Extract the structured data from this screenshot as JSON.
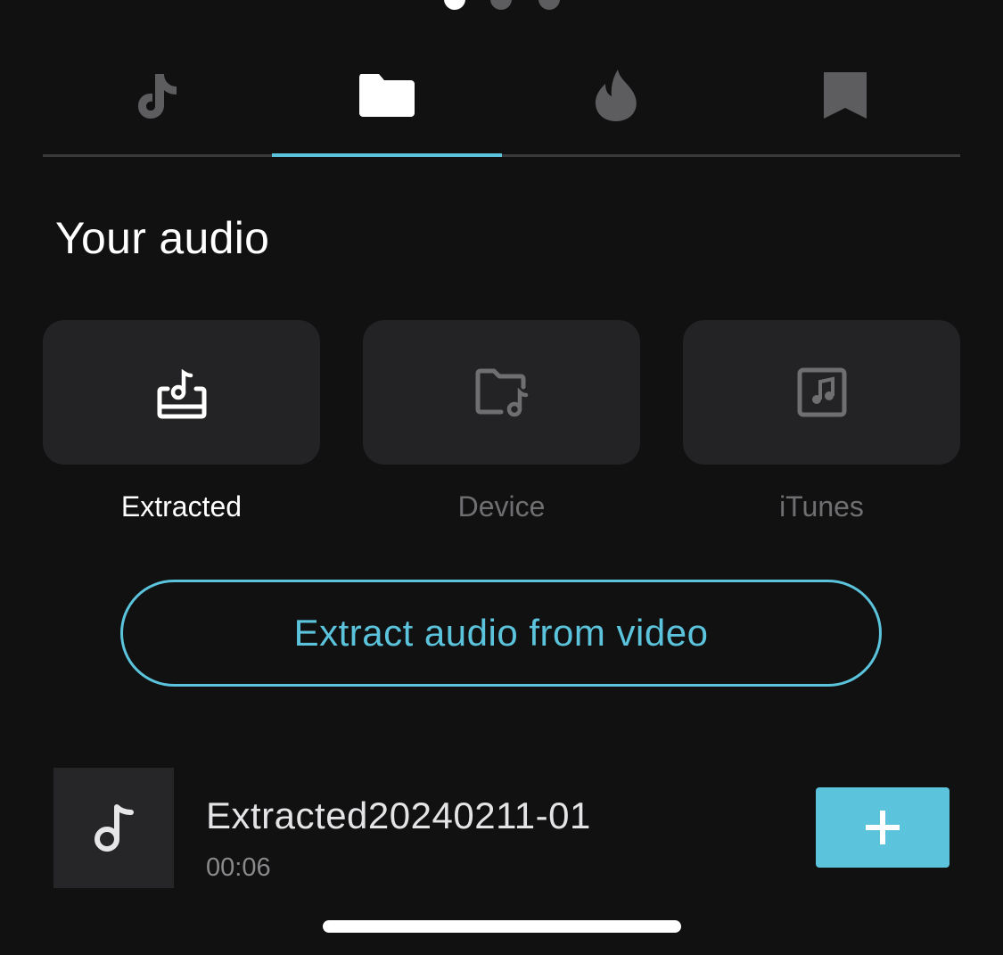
{
  "page_dots": {
    "count": 3,
    "active_index": 0
  },
  "tabs": [
    {
      "id": "tiktok",
      "icon": "tiktok-icon",
      "active": false
    },
    {
      "id": "folder",
      "icon": "folder-icon",
      "active": true
    },
    {
      "id": "trending",
      "icon": "flame-icon",
      "active": false
    },
    {
      "id": "saved",
      "icon": "bookmark-icon",
      "active": false
    }
  ],
  "section_title": "Your audio",
  "sources": [
    {
      "label": "Extracted",
      "icon": "extracted-audio-icon",
      "active": true
    },
    {
      "label": "Device",
      "icon": "folder-music-icon",
      "active": false
    },
    {
      "label": "iTunes",
      "icon": "itunes-music-icon",
      "active": false
    }
  ],
  "extract_button_label": "Extract audio from video",
  "audio_items": [
    {
      "name": "Extracted20240211-01",
      "duration": "00:06",
      "icon": "music-note-icon"
    }
  ],
  "colors": {
    "accent": "#5bc4dc",
    "background": "#111112",
    "card": "#232325",
    "inactive_icon": "#5d5d60"
  }
}
